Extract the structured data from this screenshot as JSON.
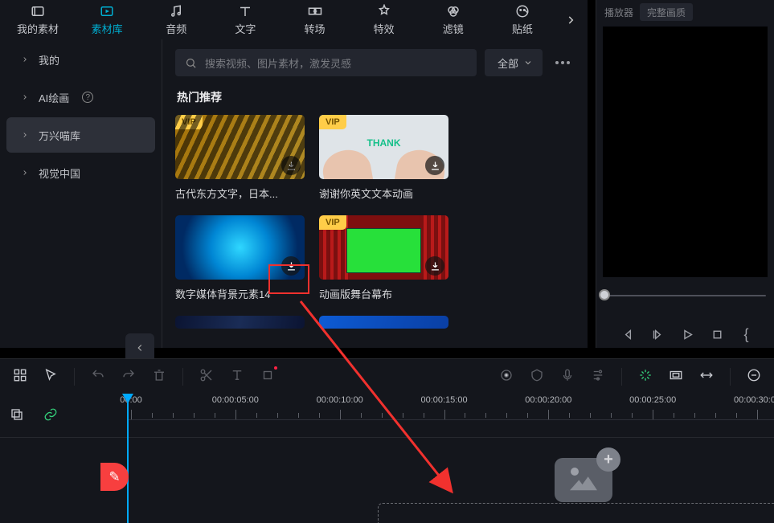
{
  "tabs": [
    {
      "id": "my-assets",
      "label": "我的素材",
      "icon": "my-icon"
    },
    {
      "id": "library",
      "label": "素材库",
      "icon": "library-icon",
      "active": true
    },
    {
      "id": "audio",
      "label": "音频",
      "icon": "audio-icon"
    },
    {
      "id": "text",
      "label": "文字",
      "icon": "text-icon"
    },
    {
      "id": "transition",
      "label": "转场",
      "icon": "transition-icon"
    },
    {
      "id": "effects",
      "label": "特效",
      "icon": "effects-icon"
    },
    {
      "id": "filter",
      "label": "滤镜",
      "icon": "filter-icon"
    },
    {
      "id": "sticker",
      "label": "贴纸",
      "icon": "sticker-icon"
    }
  ],
  "sidebar": {
    "items": [
      {
        "label": "我的"
      },
      {
        "label": "AI绘画",
        "help": true
      },
      {
        "label": "万兴喵库",
        "active": true
      },
      {
        "label": "视觉中国"
      }
    ]
  },
  "search": {
    "placeholder": "搜索视频、图片素材，激发灵感"
  },
  "filter": {
    "label": "全部"
  },
  "section": {
    "title": "热门推荐"
  },
  "cards": [
    {
      "title": "古代东方文字，日本...",
      "vip": true,
      "kind": "calligraphy"
    },
    {
      "title": "谢谢你英文文本动画",
      "vip": true,
      "kind": "thank",
      "thank_text": "THANK"
    },
    {
      "title": "数字媒体背景元素14",
      "vip": false,
      "kind": "digital",
      "highlight": true
    },
    {
      "title": "动画版舞台幕布",
      "vip": true,
      "kind": "stage"
    }
  ],
  "vip_badge": "VIP",
  "preview": {
    "panel_label": "播放器",
    "quality_label": "完整画质"
  },
  "ruler": {
    "labels": [
      "00:00",
      "00:00:05:00",
      "00:00:10:00",
      "00:00:15:00",
      "00:00:20:00",
      "00:00:25:00",
      "00:00:30:00"
    ]
  }
}
